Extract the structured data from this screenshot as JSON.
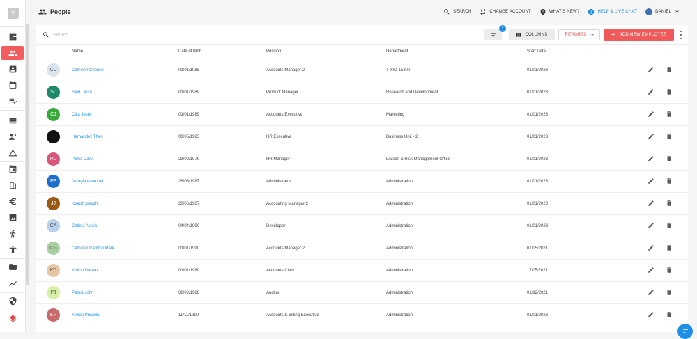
{
  "sidebar": {
    "logo_letter": "Y",
    "items": [
      {
        "icon": "dashboard-icon"
      },
      {
        "icon": "people-icon",
        "active": true
      },
      {
        "icon": "contact-card-icon"
      },
      {
        "icon": "calendar-icon"
      },
      {
        "icon": "checklist-icon"
      },
      {
        "icon": "list-icon"
      },
      {
        "icon": "person-voice-icon"
      },
      {
        "icon": "triangle-icon"
      },
      {
        "icon": "event-icon"
      },
      {
        "icon": "building-icon"
      },
      {
        "icon": "euro-icon"
      },
      {
        "icon": "chart-box-icon"
      },
      {
        "icon": "walking-icon"
      },
      {
        "icon": "accessibility-icon"
      },
      {
        "icon": "folder-icon"
      },
      {
        "icon": "trend-icon"
      },
      {
        "icon": "shield-icon"
      },
      {
        "icon": "layers-icon"
      }
    ]
  },
  "header": {
    "title": "People",
    "actions": {
      "search": "SEARCH",
      "change_account": "CHANGE ACCOUNT",
      "whats_new": "WHAT'S NEW?",
      "help": "HELP & LIVE CHAT",
      "user": "DANIEL"
    }
  },
  "toolbar": {
    "search_placeholder": "Search",
    "filter_badge": "1",
    "columns_label": "COLUMNS",
    "reports_label": "REPORTS",
    "add_label": "ADD NEW EMPLOYEE"
  },
  "table": {
    "columns": [
      "Name",
      "Date of Birth",
      "Position",
      "Department",
      "Start Date"
    ],
    "rows": [
      {
        "initials": "CC",
        "name": "Camilleri Cherise",
        "dob": "01/01/1988",
        "position": "Accounts Manager 2",
        "department": "T-XIO-15800",
        "start": "01/01/2023",
        "avatar_bg": "#dbe3ef",
        "avatar_fg": "#555555"
      },
      {
        "initials": "SL",
        "name": "Said Laura",
        "dob": "01/01/1989",
        "position": "Product Manager",
        "department": "Research and Development",
        "start": "01/01/2023",
        "avatar_bg": "#1d8a6b",
        "avatar_fg": "#ffffff"
      },
      {
        "initials": "CJ",
        "name": "Cilia Josef",
        "dob": "01/01/1989",
        "position": "Accounts Executive",
        "department": "Marketing",
        "start": "01/01/2023",
        "avatar_bg": "#3aa83a",
        "avatar_fg": "#ffffff"
      },
      {
        "initials": "",
        "name": "Hernandez Theo",
        "dob": "06/05/1983",
        "position": "HR Executive",
        "department": "Business Unit - 2",
        "start": "01/01/2023",
        "avatar_bg": "#111111",
        "avatar_fg": "#ffffff"
      },
      {
        "initials": "PD",
        "name": "Parks Dana",
        "dob": "23/09/1979",
        "position": "HR Manager",
        "department": "Liaison & Risk Management Office",
        "start": "01/01/2023",
        "avatar_bg": "#d9557a",
        "avatar_fg": "#ffffff"
      },
      {
        "initials": "FE",
        "name": "farrugia emanuel",
        "dob": "26/06/1987",
        "position": "Administrator",
        "department": "Administration",
        "start": "01/01/2023",
        "avatar_bg": "#1f6fd0",
        "avatar_fg": "#ffffff"
      },
      {
        "initials": "JJ",
        "name": "joseph joseph",
        "dob": "26/06/1987",
        "position": "Accounting Manager 2",
        "department": "Administration",
        "start": "01/01/2023",
        "avatar_bg": "#9a5a14",
        "avatar_fg": "#ffffff"
      },
      {
        "initials": "CA",
        "name": "Calleja Alexia",
        "dob": "04/04/1990",
        "position": "Developer",
        "department": "Administration",
        "start": "01/01/2023",
        "avatar_bg": "#b9d1ec",
        "avatar_fg": "#555555"
      },
      {
        "initials": "CG",
        "name": "Camilleri Gambin Mark",
        "dob": "01/01/1990",
        "position": "Accounts Manager 2",
        "department": "Administration",
        "start": "01/05/2021",
        "avatar_bg": "#a9cfa0",
        "avatar_fg": "#555555"
      },
      {
        "initials": "KD",
        "name": "Kirkop Darren",
        "dob": "01/01/1980",
        "position": "Accounts Clerk",
        "department": "Administration",
        "start": "17/05/2021",
        "avatar_bg": "#e8c6a3",
        "avatar_fg": "#555555"
      },
      {
        "initials": "PJ",
        "name": "Pamis John",
        "dob": "02/02/1988",
        "position": "Auditor",
        "department": "Administration",
        "start": "01/12/2021",
        "avatar_bg": "#d7f0a6",
        "avatar_fg": "#555555"
      },
      {
        "initials": "KP",
        "name": "Kirkop Priscilla",
        "dob": "11/11/1990",
        "position": "Accounts & Billing Executive",
        "department": "Administration",
        "start": "01/01/2023",
        "avatar_bg": "#c96a6a",
        "avatar_fg": "#ffffff"
      }
    ]
  }
}
